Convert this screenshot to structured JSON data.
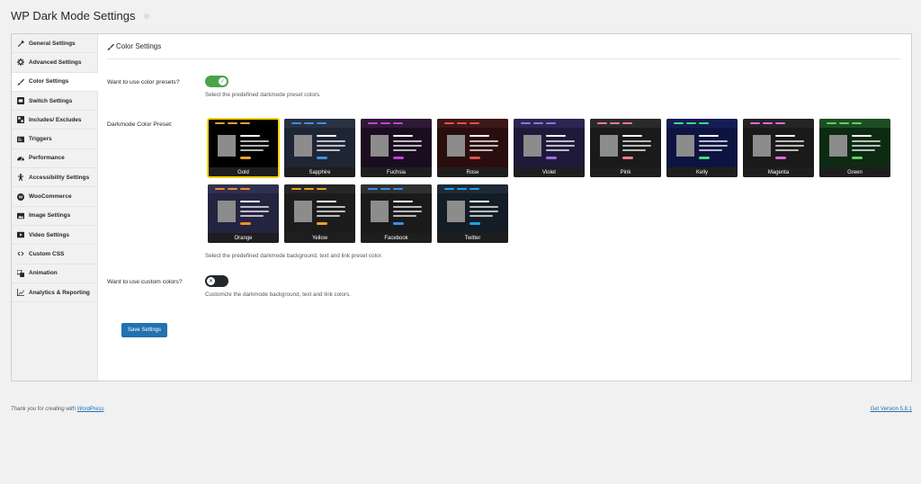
{
  "header": {
    "title": "WP Dark Mode Settings"
  },
  "sidebar": {
    "items": [
      {
        "label": "General Settings",
        "icon": "wrench-icon"
      },
      {
        "label": "Advanced Settings",
        "icon": "gear-icon"
      },
      {
        "label": "Color Settings",
        "icon": "brush-icon",
        "active": true
      },
      {
        "label": "Switch Settings",
        "icon": "switch-icon"
      },
      {
        "label": "Includes/ Excludes",
        "icon": "grid-icon"
      },
      {
        "label": "Triggers",
        "icon": "trigger-icon"
      },
      {
        "label": "Performance",
        "icon": "gauge-icon"
      },
      {
        "label": "Accessibility Settings",
        "icon": "accessibility-icon"
      },
      {
        "label": "WooCommerce",
        "icon": "woocommerce-icon"
      },
      {
        "label": "Image Settings",
        "icon": "image-icon"
      },
      {
        "label": "Video Settings",
        "icon": "video-icon"
      },
      {
        "label": "Custom CSS",
        "icon": "code-icon"
      },
      {
        "label": "Animation",
        "icon": "animation-icon"
      },
      {
        "label": "Analytics & Reporting",
        "icon": "chart-icon"
      }
    ]
  },
  "main": {
    "section_title": "Color Settings",
    "presets_toggle": {
      "label": "Want to use color presets?",
      "on": true,
      "description": "Select the predefined darkmode preset colors."
    },
    "preset_label": "Darkmode Color Preset:",
    "presets": [
      {
        "name": "Gold",
        "bg": "#000000",
        "top": "#000000",
        "accent": "#f0a020",
        "text": "#ffffff",
        "selected": true
      },
      {
        "name": "Sapphire",
        "bg": "#1e2535",
        "top": "#2a3142",
        "accent": "#3b8fe6",
        "text": "#ffffff"
      },
      {
        "name": "Fuchsia",
        "bg": "#1a0d20",
        "top": "#2e1a36",
        "accent": "#c440d8",
        "text": "#ffffff"
      },
      {
        "name": "Rose",
        "bg": "#2a0d0d",
        "top": "#3d1818",
        "accent": "#e05050",
        "text": "#ffffff"
      },
      {
        "name": "Violet",
        "bg": "#1e1a3a",
        "top": "#2b2650",
        "accent": "#9a6ee0",
        "text": "#ffffff"
      },
      {
        "name": "Pink",
        "bg": "#1a1a1a",
        "top": "#2a2a2a",
        "accent": "#f07a8c",
        "text": "#ffffff"
      },
      {
        "name": "Kelly",
        "bg": "#0e1440",
        "top": "#161d55",
        "accent": "#3ddc84",
        "text": "#ffffff"
      },
      {
        "name": "Magenta",
        "bg": "#1a1a1a",
        "top": "#242424",
        "accent": "#e068d8",
        "text": "#ffffff"
      },
      {
        "name": "Green",
        "bg": "#0d2a12",
        "top": "#1e4d25",
        "accent": "#60d060",
        "text": "#ffffff"
      },
      {
        "name": "Orange",
        "bg": "#242440",
        "top": "#303050",
        "accent": "#f08a30",
        "text": "#ffffff"
      },
      {
        "name": "Yellow",
        "bg": "#1c1c1c",
        "top": "#262626",
        "accent": "#f0a020",
        "text": "#ffffff"
      },
      {
        "name": "Facebook",
        "bg": "#1a1a1a",
        "top": "#303030",
        "accent": "#3b8fe6",
        "text": "#ffffff"
      },
      {
        "name": "Twitter",
        "bg": "#141d26",
        "top": "#1f2a36",
        "accent": "#1da1f2",
        "text": "#ffffff"
      }
    ],
    "preset_description": "Select the predefined darkmode background, text and link preset color.",
    "custom_toggle": {
      "label": "Want to use custom colors?",
      "on": false,
      "description": "Customize the darkmode background, text and link colors."
    },
    "save_label": "Save Settings"
  },
  "footer": {
    "thanks_prefix": "Thank you for creating with ",
    "thanks_link": "WordPress",
    "thanks_suffix": ".",
    "version": "Get Version 5.8.1"
  }
}
